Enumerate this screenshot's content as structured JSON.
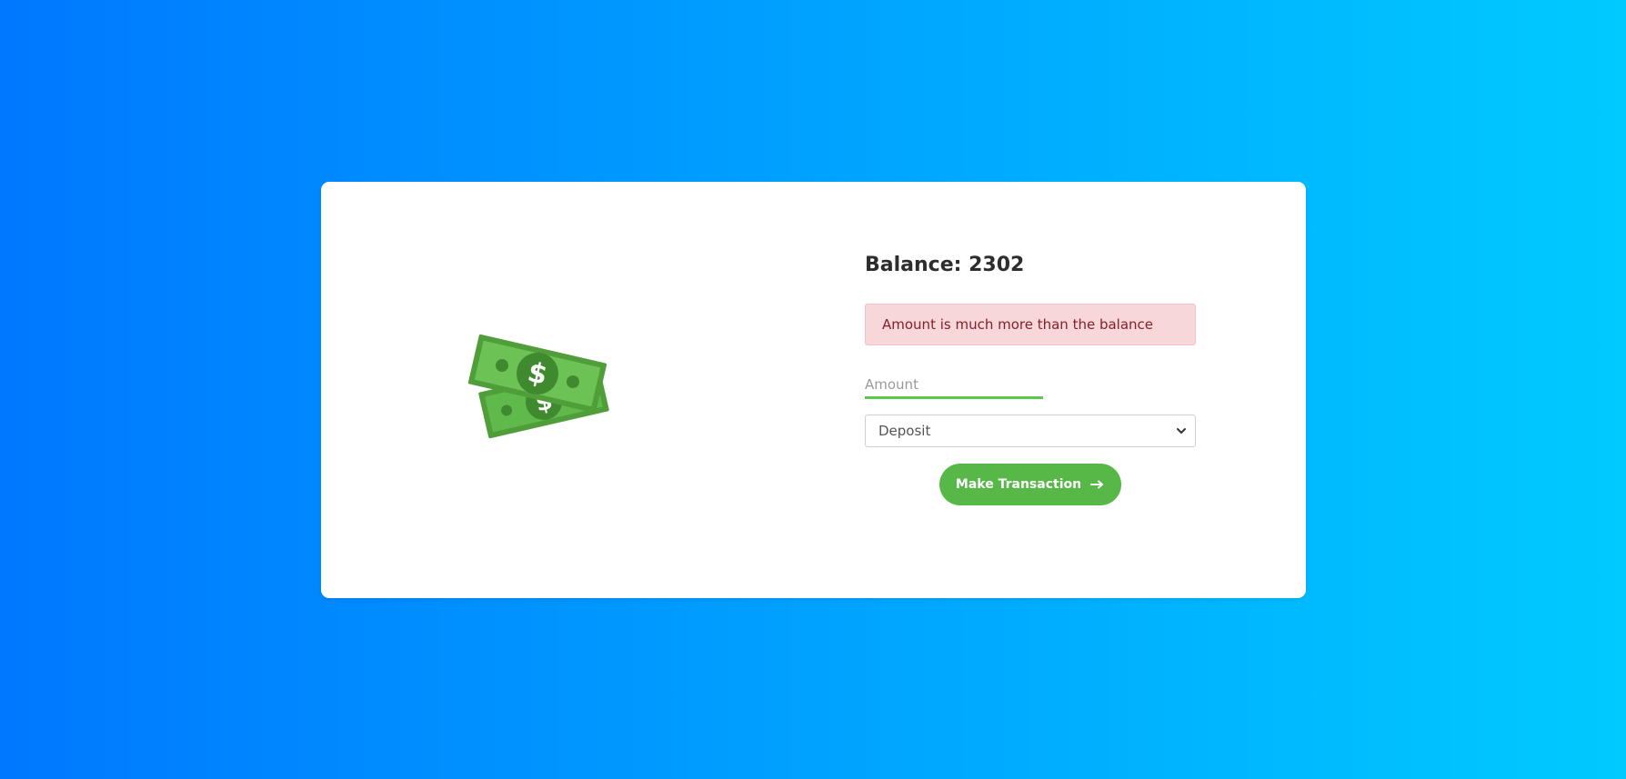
{
  "balance": {
    "label": "Balance: 2302"
  },
  "alert": {
    "message": "Amount is much more than the balance"
  },
  "amount": {
    "placeholder": "Amount",
    "value": ""
  },
  "transaction_type": {
    "selected": "Deposit",
    "options": [
      "Deposit"
    ]
  },
  "submit": {
    "label": "Make Transaction"
  },
  "icons": {
    "illustration": "money-bills-icon",
    "submit": "arrow-right-icon",
    "select": "chevron-down-icon"
  },
  "colors": {
    "accent": "#57b847",
    "alert_bg": "#f8d7da",
    "alert_text": "#842029",
    "background_start": "#0078ff",
    "background_end": "#00caff"
  }
}
